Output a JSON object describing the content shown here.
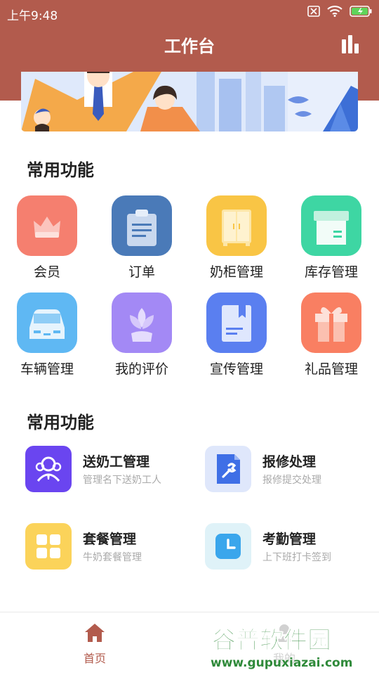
{
  "status_bar": {
    "time": "上午9:48"
  },
  "header": {
    "title": "工作台"
  },
  "sections": {
    "common_title": "常用功能",
    "manage_title": "常用功能"
  },
  "features": [
    {
      "label": "会员",
      "icon": "crown-icon",
      "color": "#f57f6f"
    },
    {
      "label": "订单",
      "icon": "clipboard-icon",
      "color": "#4a7ab8"
    },
    {
      "label": "奶柜管理",
      "icon": "cabinet-icon",
      "color": "#f9c545"
    },
    {
      "label": "库存管理",
      "icon": "box-icon",
      "color": "#3ed6a3"
    },
    {
      "label": "车辆管理",
      "icon": "car-icon",
      "color": "#5fb8f3"
    },
    {
      "label": "我的评价",
      "icon": "flower-icon",
      "color": "#a389f5"
    },
    {
      "label": "宣传管理",
      "icon": "book-icon",
      "color": "#5a7ff0"
    },
    {
      "label": "礼品管理",
      "icon": "gift-icon",
      "color": "#f97f62"
    }
  ],
  "management": [
    {
      "title": "送奶工管理",
      "subtitle": "管理名下送奶工人",
      "icon": "users-icon",
      "color": "#6a45f0"
    },
    {
      "title": "报修处理",
      "subtitle": "报修提交处理",
      "icon": "wrench-document-icon",
      "color": "#dfe7fb"
    },
    {
      "title": "套餐管理",
      "subtitle": "牛奶套餐管理",
      "icon": "grid-icon",
      "color": "#fbd35a"
    },
    {
      "title": "考勤管理",
      "subtitle": "上下班打卡签到",
      "icon": "clock-icon",
      "color": "#dff2f8"
    }
  ],
  "tabbar": {
    "home_label": "首页",
    "mine_label": "我的",
    "active_color": "#b25b4d"
  },
  "watermark": {
    "line1": "谷普软件园",
    "line2": "www.gupuxiazai.com"
  }
}
